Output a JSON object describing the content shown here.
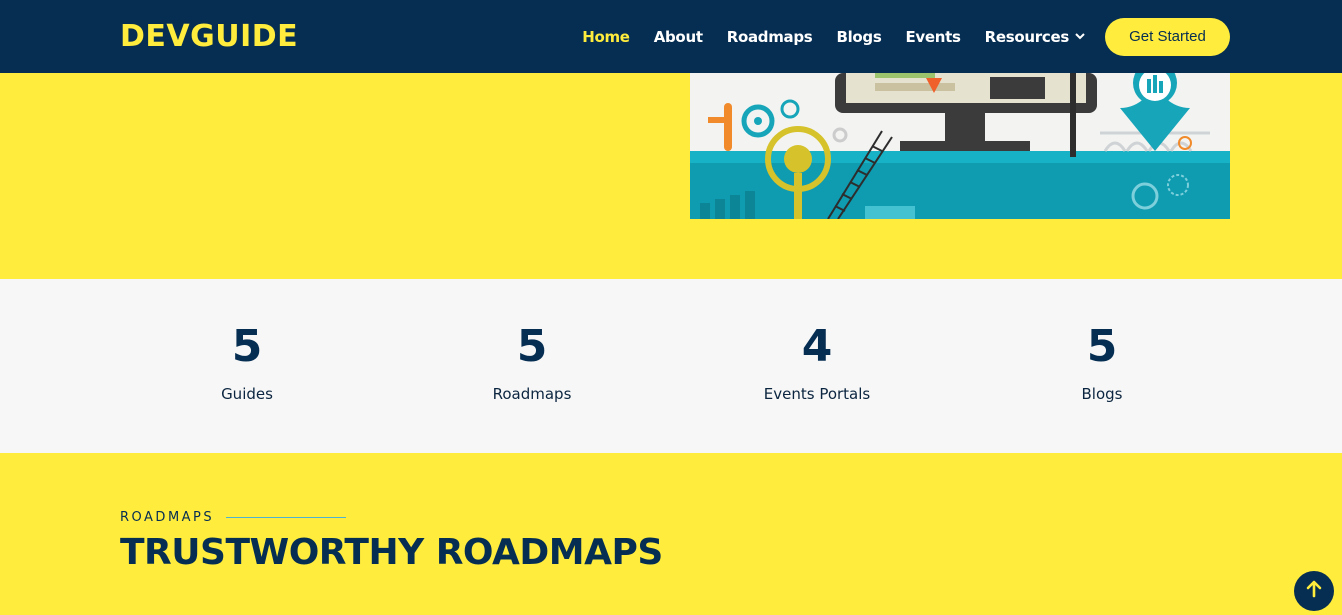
{
  "header": {
    "logo": "DEVGUIDE",
    "nav": [
      {
        "label": "Home",
        "active": true
      },
      {
        "label": "About"
      },
      {
        "label": "Roadmaps"
      },
      {
        "label": "Blogs"
      },
      {
        "label": "Events"
      },
      {
        "label": "Resources",
        "has_dropdown": true,
        "icon": "chevron-down-icon"
      }
    ],
    "cta_label": "Get Started"
  },
  "stats": [
    {
      "value": "5",
      "label": "Guides"
    },
    {
      "value": "5",
      "label": "Roadmaps"
    },
    {
      "value": "4",
      "label": "Events Portals"
    },
    {
      "value": "5",
      "label": "Blogs"
    }
  ],
  "roadmaps": {
    "eyebrow": "ROADMAPS",
    "title": "TRUSTWORTHY ROADMAPS"
  },
  "scroll_top": {
    "icon": "arrow-up-icon"
  },
  "colors": {
    "navy": "#062e52",
    "yellow": "#ffec3d",
    "light_band": "#f7f7f7",
    "teal": "#14a3b8"
  }
}
